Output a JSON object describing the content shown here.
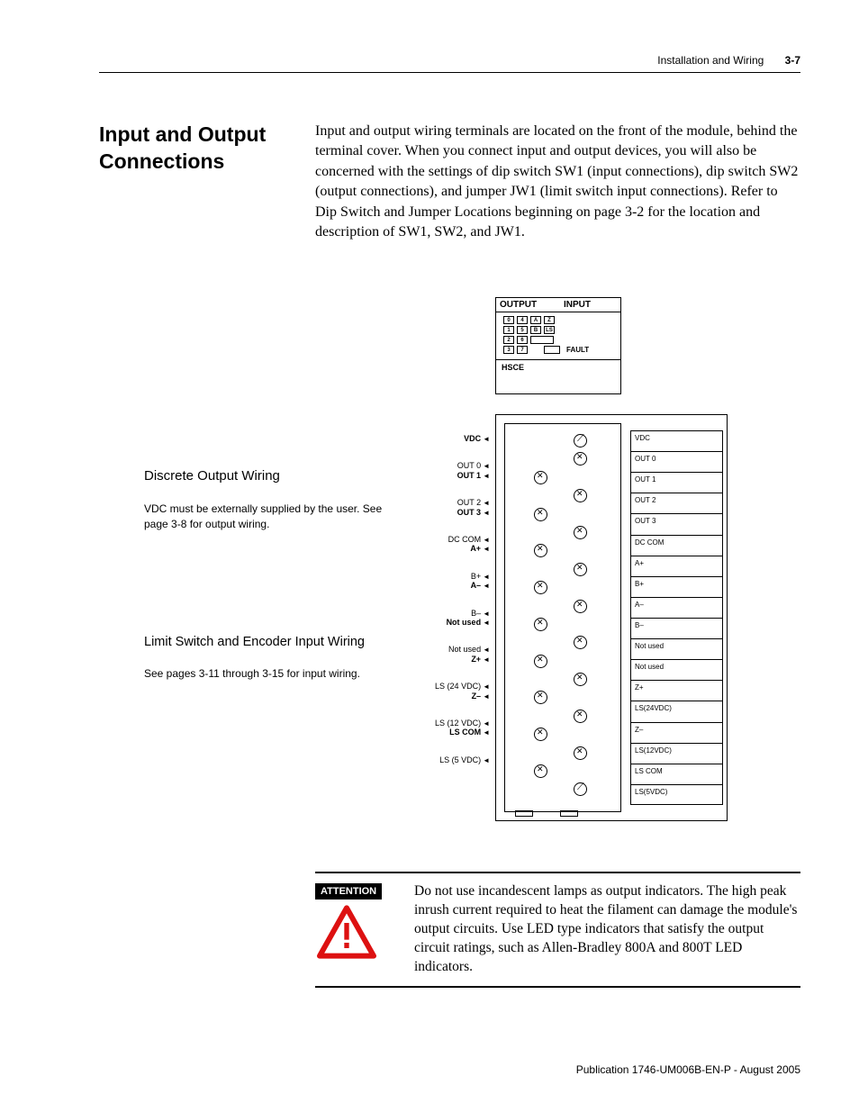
{
  "header": {
    "chapter": "Installation and Wiring",
    "page": "3-7"
  },
  "section": {
    "title": "Input and Output Connections",
    "body": "Input and output wiring terminals are located on the front of the module, behind the terminal cover. When you connect input and output devices, you will also be concerned with the settings of dip switch SW1 (input connections), dip switch SW2 (output connections), and jumper JW1 (limit switch input connections). Refer to Dip Switch and Jumper Locations beginning on page 3-2 for the location and description of SW1, SW2, and JW1."
  },
  "notes": {
    "discrete": {
      "title": "Discrete Output Wiring",
      "body": "VDC must be externally supplied by the user. See page 3-8 for output wiring."
    },
    "limit": {
      "title": "Limit Switch and Encoder Input Wiring",
      "body": "See pages 3-11 through 3-15 for input wiring."
    }
  },
  "diagram": {
    "led_header_out": "OUTPUT",
    "led_header_in": "INPUT",
    "led_rows": [
      [
        "0",
        "4",
        "A",
        "Z"
      ],
      [
        "1",
        "5",
        "B",
        "LS"
      ],
      [
        "2",
        "6",
        "",
        ""
      ],
      [
        "3",
        "7",
        "",
        "FAULT"
      ]
    ],
    "hsce": "HSCE",
    "terminal_labels": [
      {
        "text": "VDC",
        "bold": true
      },
      {
        "text": "OUT 0",
        "bold": false
      },
      {
        "text": "OUT 1",
        "bold": true
      },
      {
        "text": "OUT 2",
        "bold": false
      },
      {
        "text": "OUT 3",
        "bold": true
      },
      {
        "text": "DC COM",
        "bold": false
      },
      {
        "text": "A+",
        "bold": true
      },
      {
        "text": "B+",
        "bold": false
      },
      {
        "text": "A–",
        "bold": true
      },
      {
        "text": "B–",
        "bold": false
      },
      {
        "text": "Not used",
        "bold": true
      },
      {
        "text": "Not used",
        "bold": false
      },
      {
        "text": "Z+",
        "bold": true
      },
      {
        "text": "LS (24 VDC)",
        "bold": false
      },
      {
        "text": "Z–",
        "bold": true
      },
      {
        "text": "LS (12 VDC)",
        "bold": false
      },
      {
        "text": "LS COM",
        "bold": true
      },
      {
        "text": "LS (5 VDC)",
        "bold": false
      }
    ],
    "right_labels": [
      "VDC",
      "OUT 0",
      "OUT 1",
      "OUT 2",
      "OUT 3",
      "DC COM",
      "A+",
      "B+",
      "A–",
      "B–",
      "Not used",
      "Not used",
      "Z+",
      "LS(24VDC)",
      "Z–",
      "LS(12VDC)",
      "LS COM",
      "LS(5VDC)"
    ]
  },
  "attention": {
    "label": "ATTENTION",
    "text": "Do not use incandescent lamps as output indicators. The high peak inrush current required to heat the filament can damage the module's output circuits. Use LED type indicators that satisfy the output circuit ratings, such as Allen-Bradley 800A and 800T LED indicators."
  },
  "footer": "Publication 1746-UM006B-EN-P - August 2005"
}
